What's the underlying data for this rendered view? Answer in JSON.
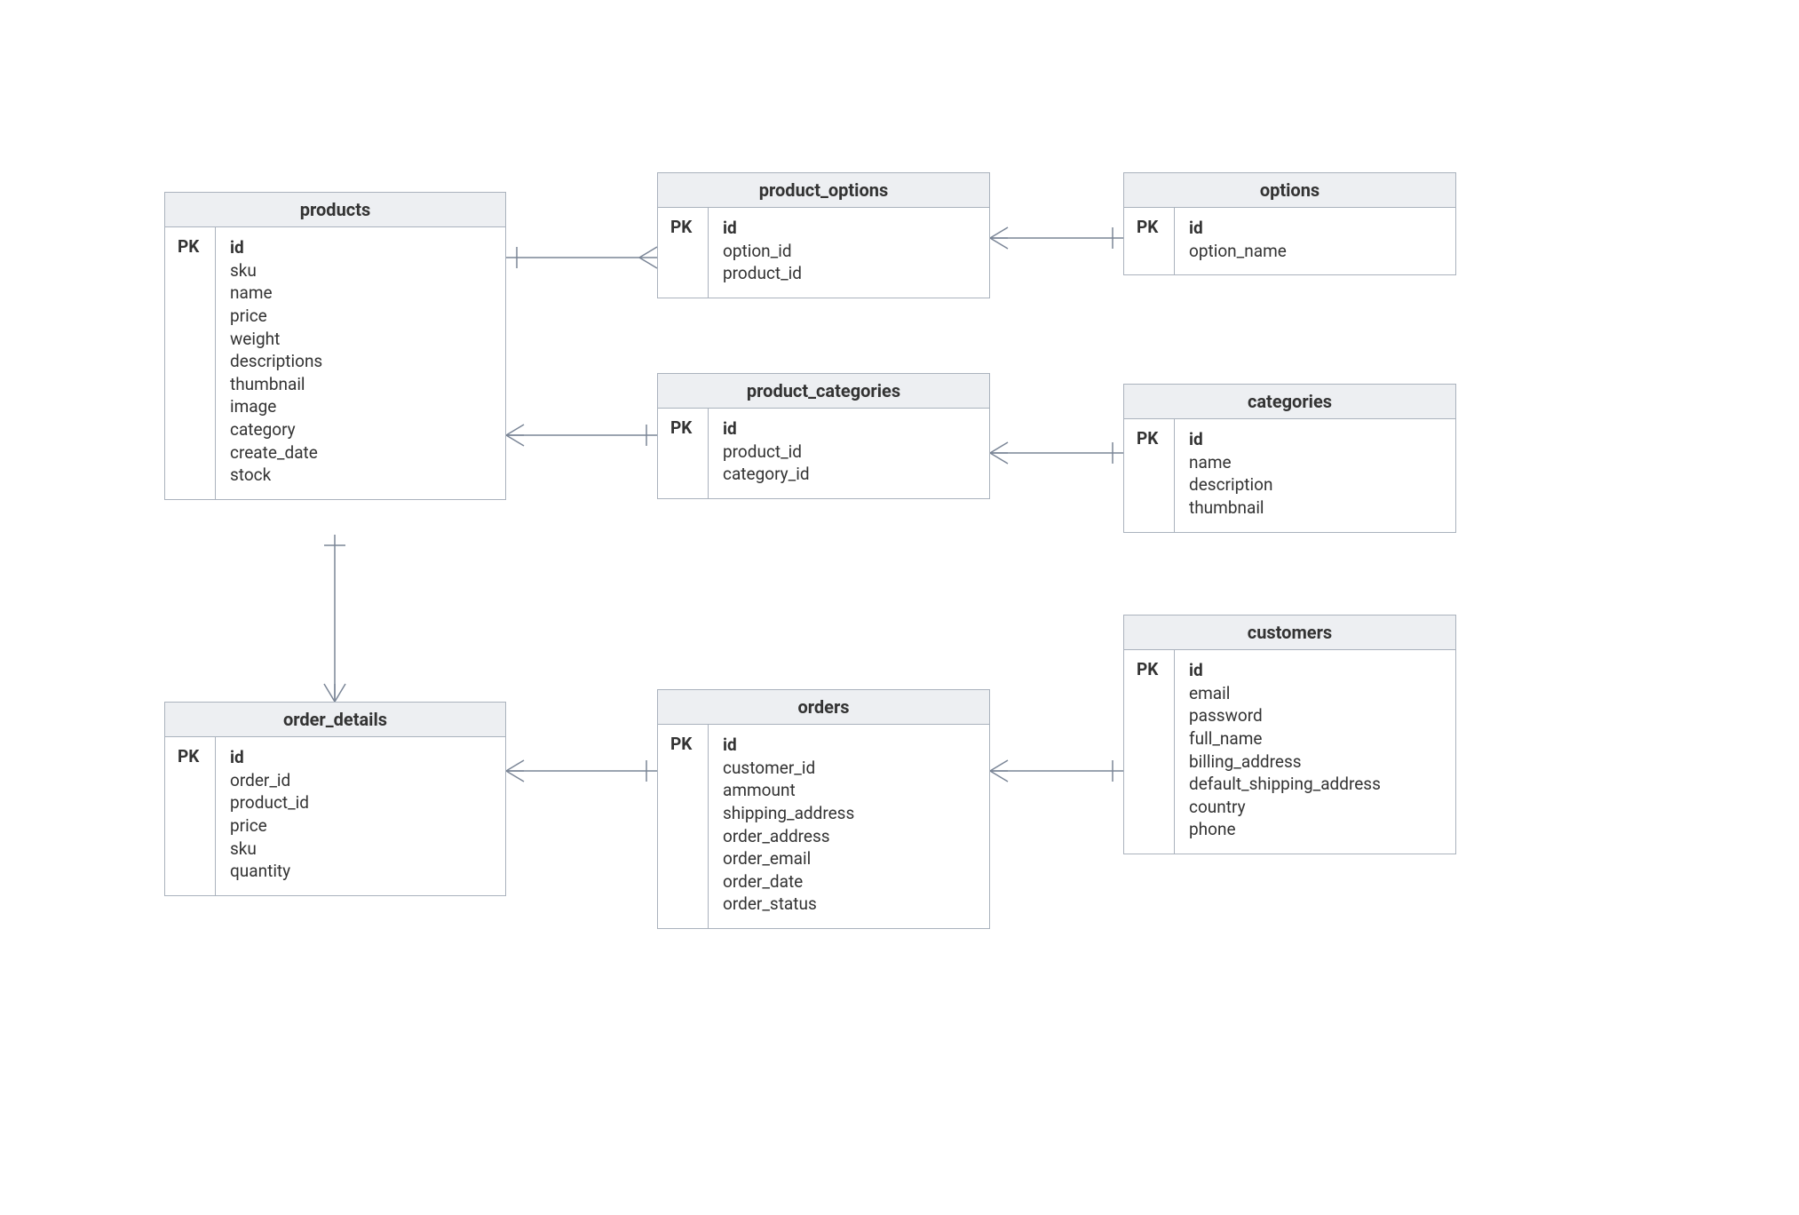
{
  "pk_label": "PK",
  "entities": {
    "products": {
      "title": "products",
      "pk": "id",
      "fields": [
        "sku",
        "name",
        "price",
        "weight",
        "descriptions",
        "thumbnail",
        "image",
        "category",
        "create_date",
        "stock"
      ]
    },
    "product_options": {
      "title": "product_options",
      "pk": "id",
      "fields": [
        "option_id",
        "product_id"
      ]
    },
    "options": {
      "title": "options",
      "pk": "id",
      "fields": [
        "option_name"
      ]
    },
    "product_categories": {
      "title": "product_categories",
      "pk": "id",
      "fields": [
        "product_id",
        "category_id"
      ]
    },
    "categories": {
      "title": "categories",
      "pk": "id",
      "fields": [
        "name",
        "description",
        "thumbnail"
      ]
    },
    "order_details": {
      "title": "order_details",
      "pk": "id",
      "fields": [
        "order_id",
        "product_id",
        "price",
        "sku",
        "quantity"
      ]
    },
    "orders": {
      "title": "orders",
      "pk": "id",
      "fields": [
        "customer_id",
        "ammount",
        "shipping_address",
        "order_address",
        "order_email",
        "order_date",
        "order_status"
      ]
    },
    "customers": {
      "title": "customers",
      "pk": "id",
      "fields": [
        "email",
        "password",
        "full_name",
        "billing_address",
        "default_shipping_address",
        "country",
        "phone"
      ]
    }
  }
}
